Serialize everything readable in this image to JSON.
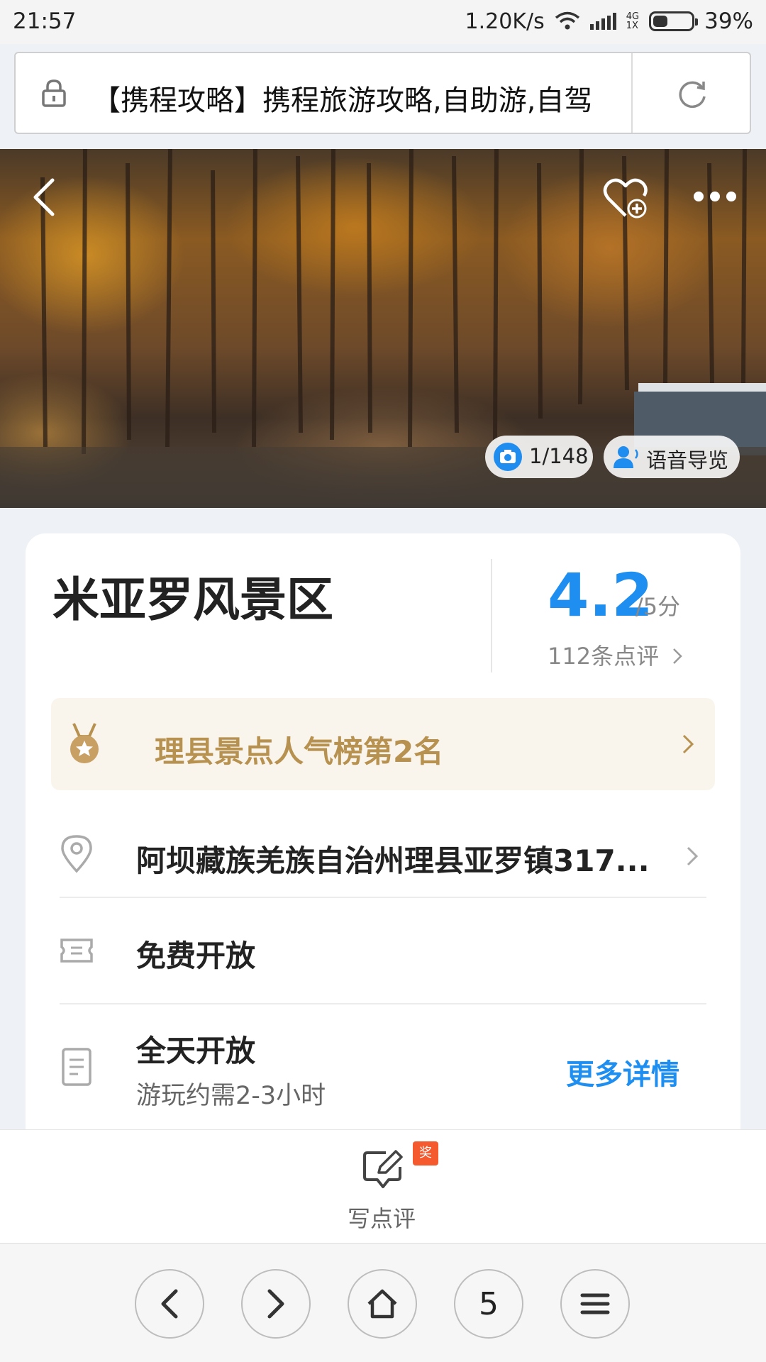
{
  "status_bar": {
    "time": "21:57",
    "net_speed": "1.20K/s",
    "network_top": "4G",
    "network_bottom": "1X",
    "battery_percent": 39,
    "battery_text": "39%"
  },
  "url_bar": {
    "title": "【携程攻略】携程旅游攻略,自助游,自驾"
  },
  "hero": {
    "photo_counter": "1/148",
    "audio_guide_label": "语音导览"
  },
  "attraction": {
    "name": "米亚罗风景区",
    "score": "4.2",
    "score_suffix": "/5分",
    "review_count": "112条点评",
    "rank_text": "理县景点人气榜第2名",
    "address": "阿坝藏族羌族自治州理县亚罗镇317...",
    "ticket": "免费开放",
    "hours": "全天开放",
    "duration": "游玩约需2-3小时",
    "more_details": "更多详情"
  },
  "review_bar": {
    "award_badge": "奖",
    "write_label": "写点评"
  },
  "nav_bar": {
    "tab_count": "5"
  },
  "colors": {
    "accent_blue": "#1e8ff0",
    "gold": "#b7914f",
    "badge_orange": "#f55a2e"
  },
  "icons": [
    "lock-icon",
    "reload-icon",
    "back-icon",
    "favorite-add-icon",
    "more-icon",
    "camera-icon",
    "audio-guide-icon",
    "medal-icon",
    "chevron-right-icon",
    "location-pin-icon",
    "ticket-icon",
    "document-icon",
    "edit-icon",
    "home-icon",
    "menu-icon"
  ]
}
